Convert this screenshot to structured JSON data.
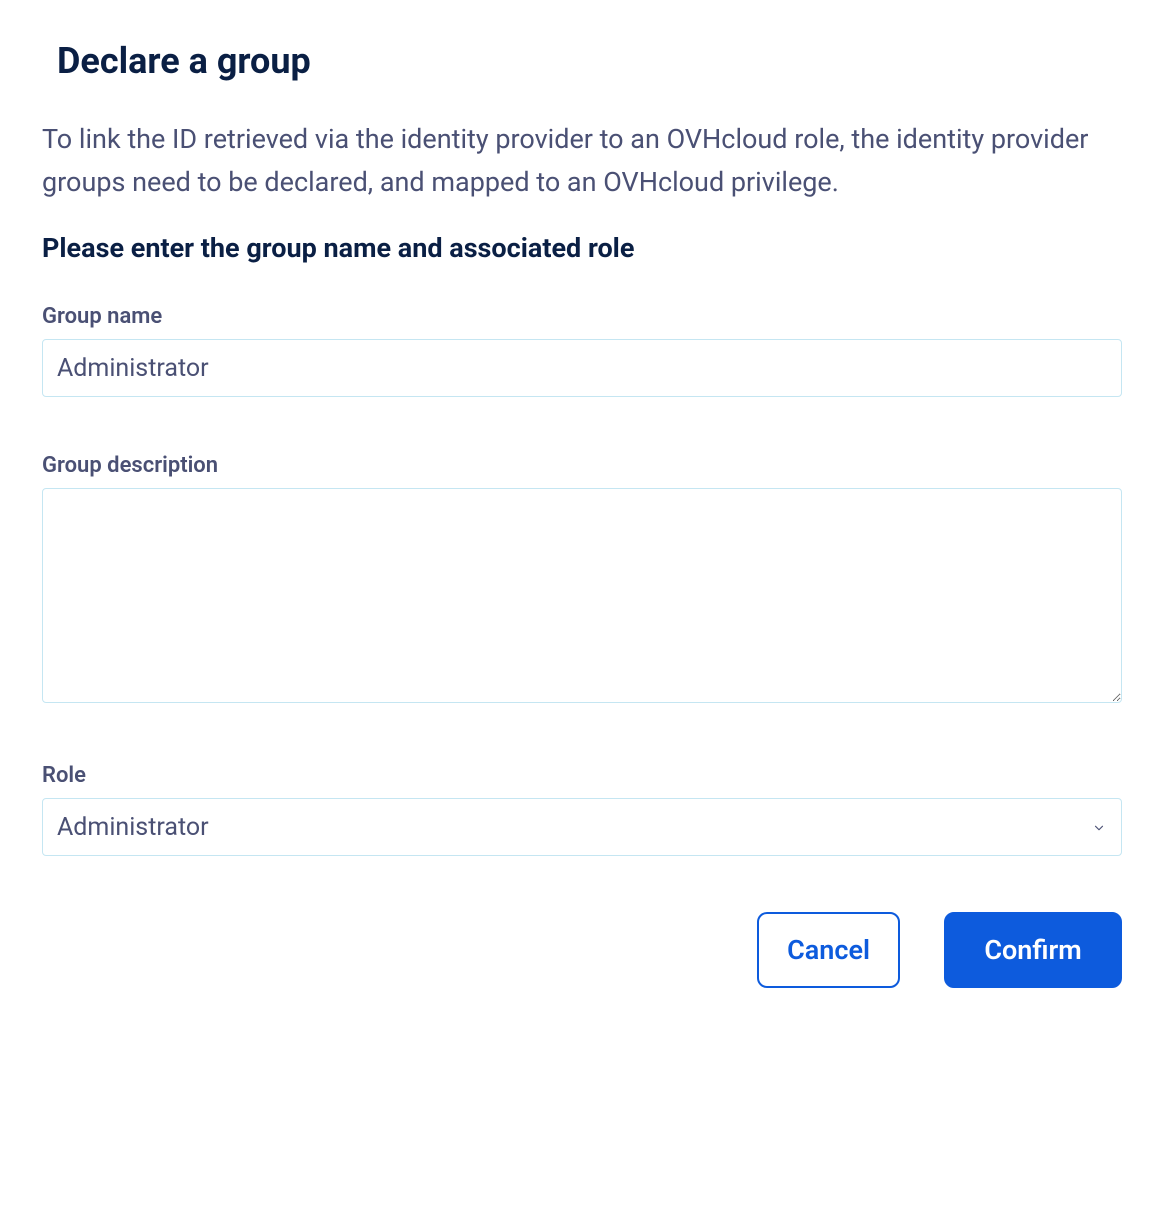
{
  "title": "Declare a group",
  "description": "To link the ID retrieved via the identity provider to an OVHcloud role, the identity provider groups need to be declared, and mapped to an OVHcloud privilege.",
  "subheading": "Please enter the group name and associated role",
  "fields": {
    "groupName": {
      "label": "Group name",
      "value": "Administrator"
    },
    "groupDescription": {
      "label": "Group description",
      "value": ""
    },
    "role": {
      "label": "Role",
      "selected": "Administrator"
    }
  },
  "buttons": {
    "cancel": "Cancel",
    "confirm": "Confirm"
  }
}
